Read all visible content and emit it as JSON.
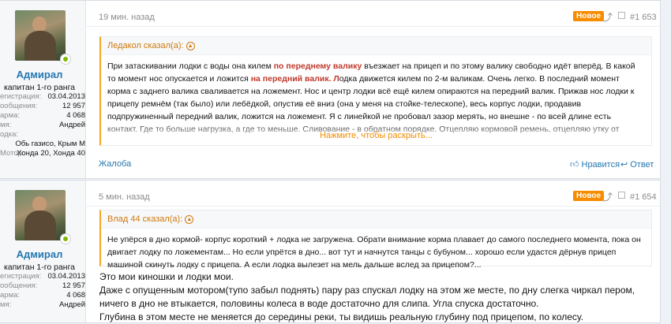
{
  "colors": {
    "accent": "#2577b1",
    "quote_accent": "#f5a623",
    "badge": "#f78c00",
    "online": "#7fb900",
    "highlight": "#c0392b"
  },
  "posts": [
    {
      "user": {
        "name": "Адмирал",
        "title": "капитан 1-го ранга",
        "stats": [
          {
            "k": "егистрация:",
            "v": "03.04.2013"
          },
          {
            "k": "ообщения:",
            "v": "12 957"
          },
          {
            "k": "арма:",
            "v": "4 068"
          },
          {
            "k": "мя:",
            "v": "Андрей"
          },
          {
            "k": "одка:",
            "v": ""
          }
        ],
        "boat": "Обь газисо, Крым М",
        "motor_label": "Мотор:",
        "motor": "Хонда 20, Хонда 40"
      },
      "time": "19 мин. назад",
      "badge": "Новое",
      "number": "#1 653",
      "quote": {
        "author": "Ледакол сказал(а):",
        "p1": "При затаскивании лодки с воды она килем ",
        "h1": "по переднему валику",
        "p2": " въезжает на прицеп и по этому валику свободно идёт вперёд. В какой то момент нос опускается и ложится ",
        "h2": "на передний валик. Л",
        "p3": "одка движется килем по 2-м валикам. Очень легко. В последний момент корма с заднего валика сваливается на ложемент. Нос и центр лодки всё ещё килем опираются на передний валик. Прижав нос лодки к прицепу ремнём (так было) или лебёдкой, опустив её вниз (она у меня на стойке-телескопе), весь корпус лодки, продавив подпружиненный передний валик, ложится на ложемент. Я с линейкой не пробовал зазор мерять, но внешне - по всей длине есть контакт. Где то больше нагрузка, а где то меньше. Сливование - в обратном порядке. Отцепляю кормовой ремень, отцепляю утку от лебёдки. Нос подняла на переднем подпружиненном валике и вывешен над ложементами. Чуть качнув за утку ставлю корму на задний валик. Там, как уже говорил, всего 1 см. (или менее), ступенька. Далее лодка на 2 валиках килем катится сама собой. При затаскивании и спуске лодки на ложементы не трогаю.",
        "expand": "Нажмите, чтобы раскрыть..."
      },
      "complaint": "Жалоба",
      "like": "Нравится",
      "reply": "Ответ"
    },
    {
      "user": {
        "name": "Адмирал",
        "title": "капитан 1-го ранга",
        "stats": [
          {
            "k": "егистрация:",
            "v": "03.04.2013"
          },
          {
            "k": "ообщения:",
            "v": "12 957"
          },
          {
            "k": "арма:",
            "v": "4 068"
          },
          {
            "k": "мя:",
            "v": "Андрей"
          }
        ]
      },
      "time": "5 мин. назад",
      "badge": "Новое",
      "number": "#1 654",
      "quote": {
        "author": "Влад 44 сказал(а):",
        "text": "Не упёрся в дно кормой- корпус короткий + лодка не загружена. Обрати внимание корма плавает до самого последнего момента, пока он двигает лодку по ложементам... Но если упрётся в дно... вот тут и начнутся танцы с бубуном... хорошо если удастся дёрнув прицеп машиной скинуть лодку с прицепа. А если лодка вылезет на мель дальше вслед за прицепом?..."
      },
      "body_lines": [
        "Это мои киношки и лодки мои.",
        "Даже с опущенным мотором(тупо забыл поднять) пару раз спускал лодку на этом же месте, по дну слегка чиркал пером, ничего в дно не втыкается, половины колеса в воде достаточно для слипа. Угла спуска достаточно.",
        "Глубина в этом месте не меняется до середины реки, ты видишь реальную глубину под прицепом, по колесу."
      ]
    }
  ]
}
